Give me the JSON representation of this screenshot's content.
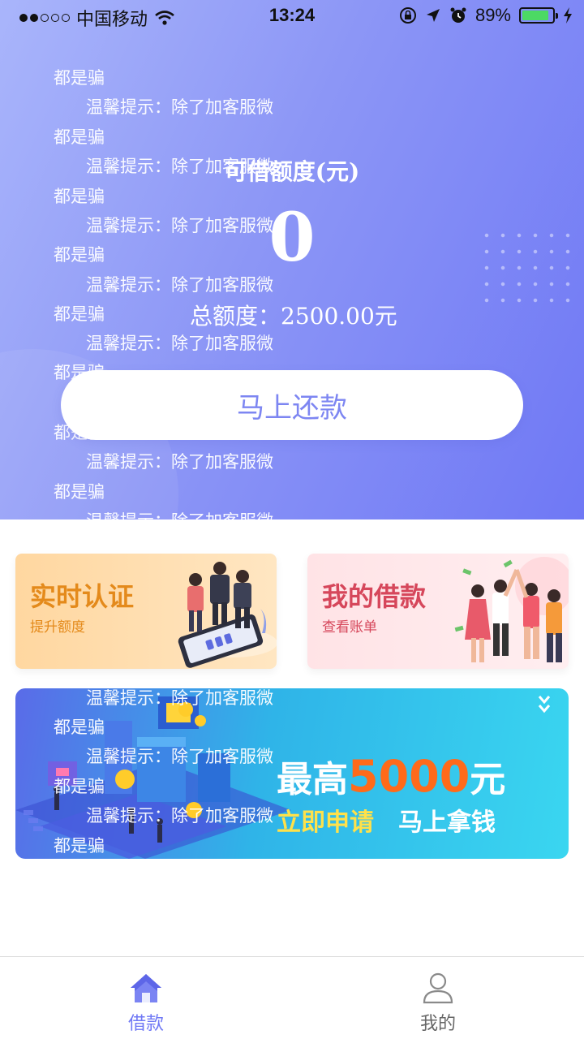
{
  "status_bar": {
    "carrier": "中国移动",
    "time": "13:24",
    "battery": "89%",
    "battery_level": 0.89,
    "signal_bars_filled": 2,
    "signal_bars_total": 5
  },
  "notice": {
    "line_a": "都是骗",
    "line_b": "温馨提示：除了加客服微"
  },
  "credit": {
    "available_label": "可借额度(元)",
    "available_value": "0",
    "total_label": "总额度：",
    "total_value": "2500.00元"
  },
  "repay_button": "马上还款",
  "cards": {
    "verify": {
      "title": "实时认证",
      "subtitle": "提升额度"
    },
    "loans": {
      "title": "我的借款",
      "subtitle": "查看账单"
    }
  },
  "banner": {
    "prefix": "最高",
    "amount": "5000",
    "suffix": "元",
    "apply": "立即申请",
    "get_money": "马上拿钱"
  },
  "tabs": [
    {
      "label": "借款"
    },
    {
      "label": "我的"
    }
  ],
  "colors": {
    "accent": "#6f78f5",
    "banner_highlight": "#ff6a1a",
    "verify_text": "#e48a1b",
    "loans_text": "#d6475b"
  }
}
